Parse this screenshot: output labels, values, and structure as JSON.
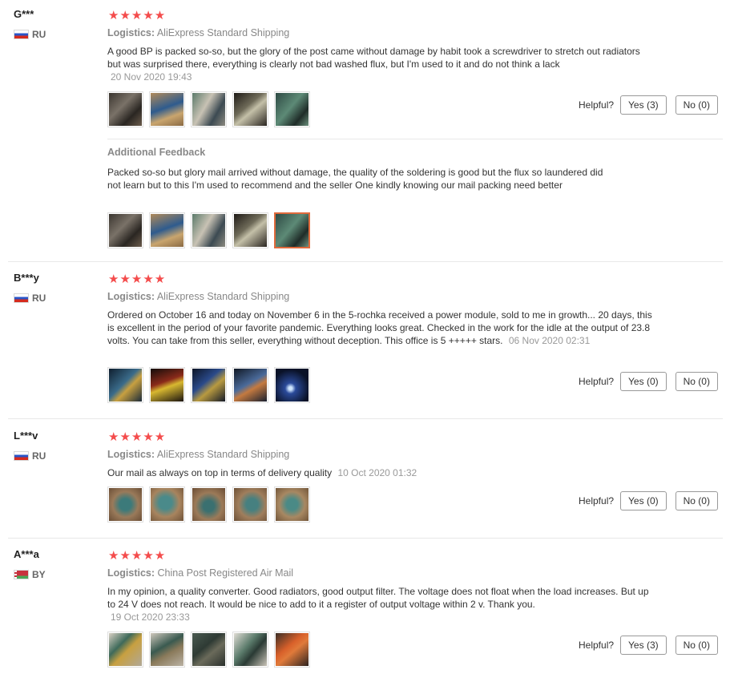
{
  "helpful_label": "Helpful?",
  "logistics_label": "Logistics:",
  "colors": {
    "star": "#f44c4c",
    "accent": "#e06a3c"
  },
  "reviews": [
    {
      "user": "G***",
      "country": "RU",
      "rating": "★★★★★",
      "logistics": "AliExpress Standard Shipping",
      "text": "A good BP is packed so-so, but the glory of the post came without damage by habit took a screwdriver to stretch out radiators but was surprised there, everything is clearly not bad washed flux, but I'm used to it and do not think a lack",
      "date": "20 Nov 2020 19:43",
      "yes": "Yes (3)",
      "no": "No (0)",
      "additional_title": "Additional Feedback",
      "additional_text": "Packed so-so but glory mail arrived without damage, the quality of the soldering is good but the flux so laundered did not learn but to this I'm used to recommend and the seller One kindly knowing our mail packing need better"
    },
    {
      "user": "B***y",
      "country": "RU",
      "rating": "★★★★★",
      "logistics": "AliExpress Standard Shipping",
      "text": "Ordered on October 16 and today on November 6 in the 5-rochka received a power module, sold to me in growth... 20 days, this is excellent in the period of your favorite pandemic. Everything looks great. Checked in the work for the idle at the output of 23.8 volts. You can take from this seller, everything without deception. This office is 5 +++++ stars.",
      "date": "06 Nov 2020 02:31",
      "yes": "Yes (0)",
      "no": "No (0)"
    },
    {
      "user": "L***v",
      "country": "RU",
      "rating": "★★★★★",
      "logistics": "AliExpress Standard Shipping",
      "text": "Our mail as always on top in terms of delivery quality",
      "date": "10 Oct 2020 01:32",
      "yes": "Yes (0)",
      "no": "No (0)"
    },
    {
      "user": "A***a",
      "country": "BY",
      "rating": "★★★★★",
      "logistics": "China Post Registered Air Mail",
      "text": "In my opinion, a quality converter. Good radiators, good output filter. The voltage does not float when the load increases. But up to 24 V does not reach. It would be nice to add to it a register of output voltage within 2 v. Thank you.",
      "date": "19 Oct 2020 23:33",
      "yes": "Yes (3)",
      "no": "No (0)"
    }
  ]
}
